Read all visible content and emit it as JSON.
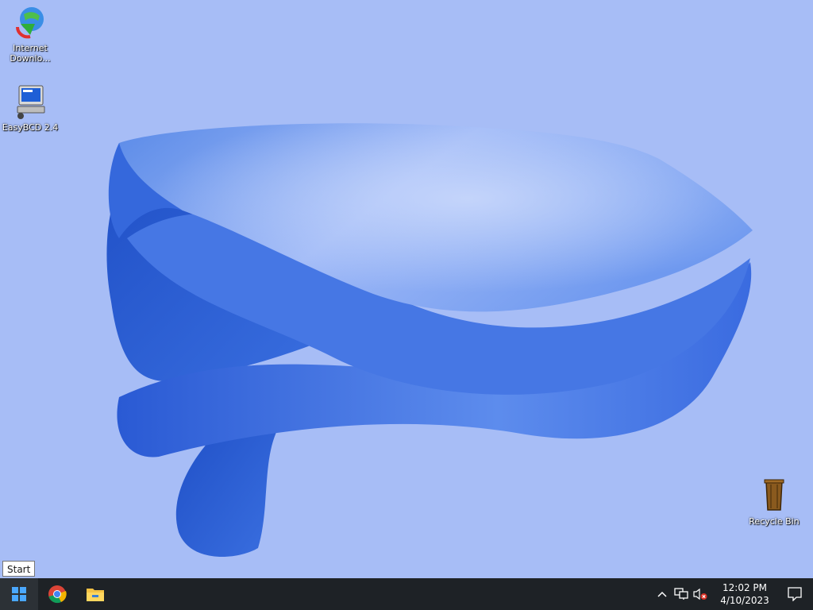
{
  "desktop": {
    "icons": [
      {
        "label": "Internet Downlo...",
        "icon": "internet-download-manager-icon"
      },
      {
        "label": "EasyBCD 2.4",
        "icon": "easybcd-icon"
      },
      {
        "label": "Recycle Bin",
        "icon": "recycle-bin-icon"
      }
    ],
    "background_color": "#a7bdf6",
    "accent_color": "#2f63d6"
  },
  "tooltip": {
    "text": "Start"
  },
  "taskbar": {
    "background_color": "#1e2226",
    "pinned": [
      {
        "icon": "windows-start-icon"
      },
      {
        "icon": "chrome-icon"
      },
      {
        "icon": "file-explorer-icon"
      }
    ],
    "tray": {
      "icons": [
        "chevron-up-icon",
        "network-icon",
        "volume-muted-icon"
      ],
      "time": "12:02 PM",
      "date": "4/10/2023",
      "notification_icon": "action-center-icon"
    }
  }
}
